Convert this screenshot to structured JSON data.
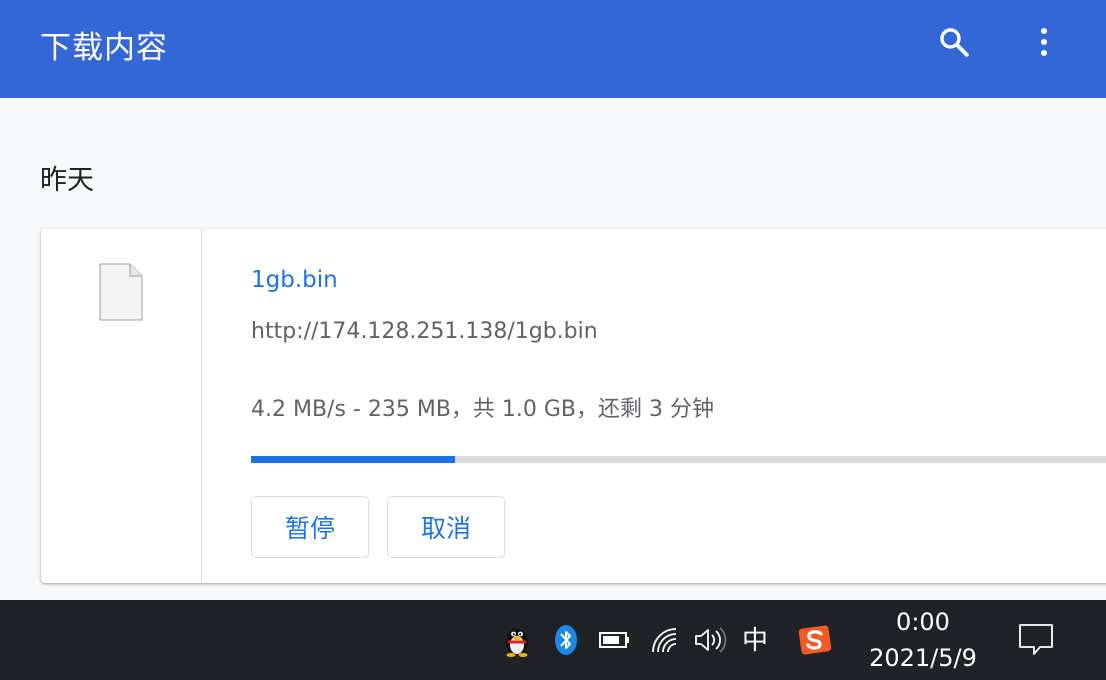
{
  "header": {
    "title": "下载内容",
    "search_icon": "search-icon",
    "more_icon": "more-vert-icon",
    "background_color": "#3367d6"
  },
  "section": {
    "label": "昨天"
  },
  "download": {
    "file_icon": "file-icon",
    "file_name": "1gb.bin",
    "url": "http://174.128.251.138/1gb.bin",
    "status": "4.2 MB/s - 235 MB，共 1.0 GB，还剩 3 分钟",
    "progress_fraction": 0.235,
    "progress_color": "#1a73e8",
    "pause_label": "暂停",
    "cancel_label": "取消"
  },
  "taskbar": {
    "tray_icons": [
      "qq-icon",
      "bluetooth-icon",
      "battery-icon",
      "wifi-icon",
      "volume-icon",
      "sogou-ime-icon",
      "notification-icon"
    ],
    "ime_label": "中",
    "time": "0:00",
    "date": "2021/5/9"
  }
}
